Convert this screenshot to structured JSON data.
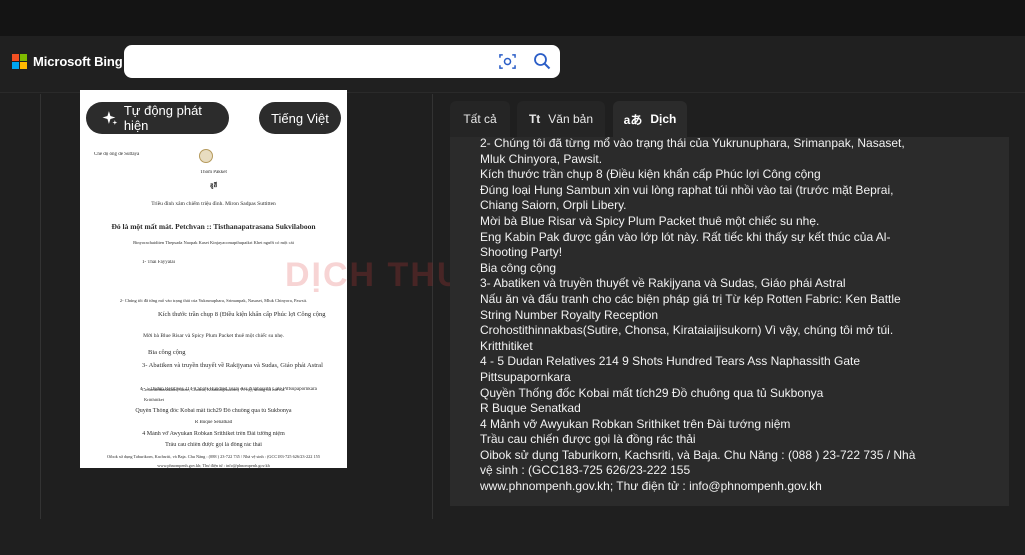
{
  "header": {
    "logo_text": "Microsoft Bing",
    "logo_colors": [
      "#f25022",
      "#7fba00",
      "#00a4ef",
      "#ffb900"
    ],
    "search_value": ""
  },
  "translator": {
    "source_lang": "Tự động phát hiện",
    "arrow": "→",
    "target_lang": "Tiếng Việt",
    "tabs": [
      {
        "icon": "",
        "label": "Tất cả"
      },
      {
        "icon": "Tt",
        "label": "Văn bản"
      },
      {
        "icon": "aあ",
        "label": "Dịch"
      }
    ],
    "lines": [
      "2- Chúng tôi đã từng mổ vào trạng thái của Yukrunuphara, Srimanpak, Nasaset,",
      "Mluk Chinyora, Pawsit.",
      "Kích thước trần chụp 8 (Điều kiện khẩn cấp Phúc lợi Công cộng",
      "Đúng loại Hung Sambun xin vui lòng raphat túi nhồi vào tai (trước mặt Beprai,",
      "Chiang Saiorn, Orpli Libery.",
      "Mời bà Blue Risar và Spicy Plum Packet thuê một chiếc su nhẹ.",
      "Eng Kabin Pak được gắn vào lớp lót này. Rất tiếc khi thấy sự kết thúc của Al-",
      "Shooting Party!",
      "Bia công cộng",
      "3- Abatiken và truyền thuyết về Rakijyana và Sudas, Giáo phái Astral",
      "Nấu ăn và đấu tranh cho các biện pháp giá trị Từ kép Rotten Fabric: Ken Battle",
      "String Number Royalty Reception",
      "Crohostithinnakbas(Sutire, Chonsa, Kirataiaijisukorn) Vì vậy, chúng tôi mở túi.",
      "Kritthitiket",
      "4 - 5 Dudan Relatives 214 9 Shots Hundred Tears Ass Naphassith Gate",
      "Pittsupapornkara",
      "Quyền Thống đốc Kobai mất tích29 Đồ chuông qua tủ Sukbonya",
      "R Buque Senatkad",
      "4 Mảnh vỡ Awyukan Robkan Srithiket trên Đài tướng niệm",
      "Trầu cau chiến được gọi là đồng rác thải",
      "Oibok sử dụng Taburikorn, Kachsriti, và Baja. Chu Năng : (088 ) 23-722 735 / Nhà",
      "vệ sinh : (GCC183-725 626/23-222 155",
      "www.phnompenh.gov.kh; Thư điện tử : info@phnompenh.gov.kh"
    ]
  },
  "document": {
    "lines": [
      "Chế độ ông đề Suttaya",
      "Thom Pakket",
      "ฮูฮี",
      "Triều đình xâm chiếm triệu đình. Miron Sadpas Suttitten",
      "Đó là một mất mát. Petchvan :: Tisthanapatrasana Sukvilaboon",
      "Binyorachaiditen Thepsada Naopak Kaset Kinjayacomapthupaikri Khet người có một cái",
      "1- Thái Fayyalai",
      "2- Chúng tôi đã từng mổ vào trạng thái của Yukrunuphara, Srimanpak, Nasaset, Mluk Chinyora, Pawsit.",
      "Kích thước trần chụp 8 (Điều kiện khẩn cấp Phúc lợi Công cộng",
      "Mời bà Blue Risar và Spicy Plum Packet thuê một chiếc su nhẹ.",
      "Bia công cộng",
      "3- Abatiken và truyền thuyết về Rakijyana và Sudas, Giáo phái Astral",
      "Crohostithinnakbas(Sutire, Chonsa, Kirataiaijisukorn) Vì vậy, chúng tôi mở túi.",
      "Kritthitiket",
      "4 - 5 Dudan Relatives 214 9 Shots Hundred Tears Ass Naphassith Gate Pittsupapornkara",
      "Quyền Thống đốc Kobai mất tích29 Đồ chuông qua tủ Sukbonya",
      "R Buque Senatkad",
      "4 Mảnh vỡ Awyukan Robkan Srithiket trên Đài tướng niệm",
      "Trầu cau chiến được gọi là đồng rác thải",
      "Oibok sử dụng Taburikorn, Kachsriti, và Baja. Chu Năng : (088 ) 23-722 735 / Nhà vệ sinh : (GCC183-725 626/23-222 155",
      "www.phnompenh.gov.kh; Thư điện tử : info@phnompenh.gov.kh"
    ]
  },
  "watermark": "DỊCH THUẬT S"
}
